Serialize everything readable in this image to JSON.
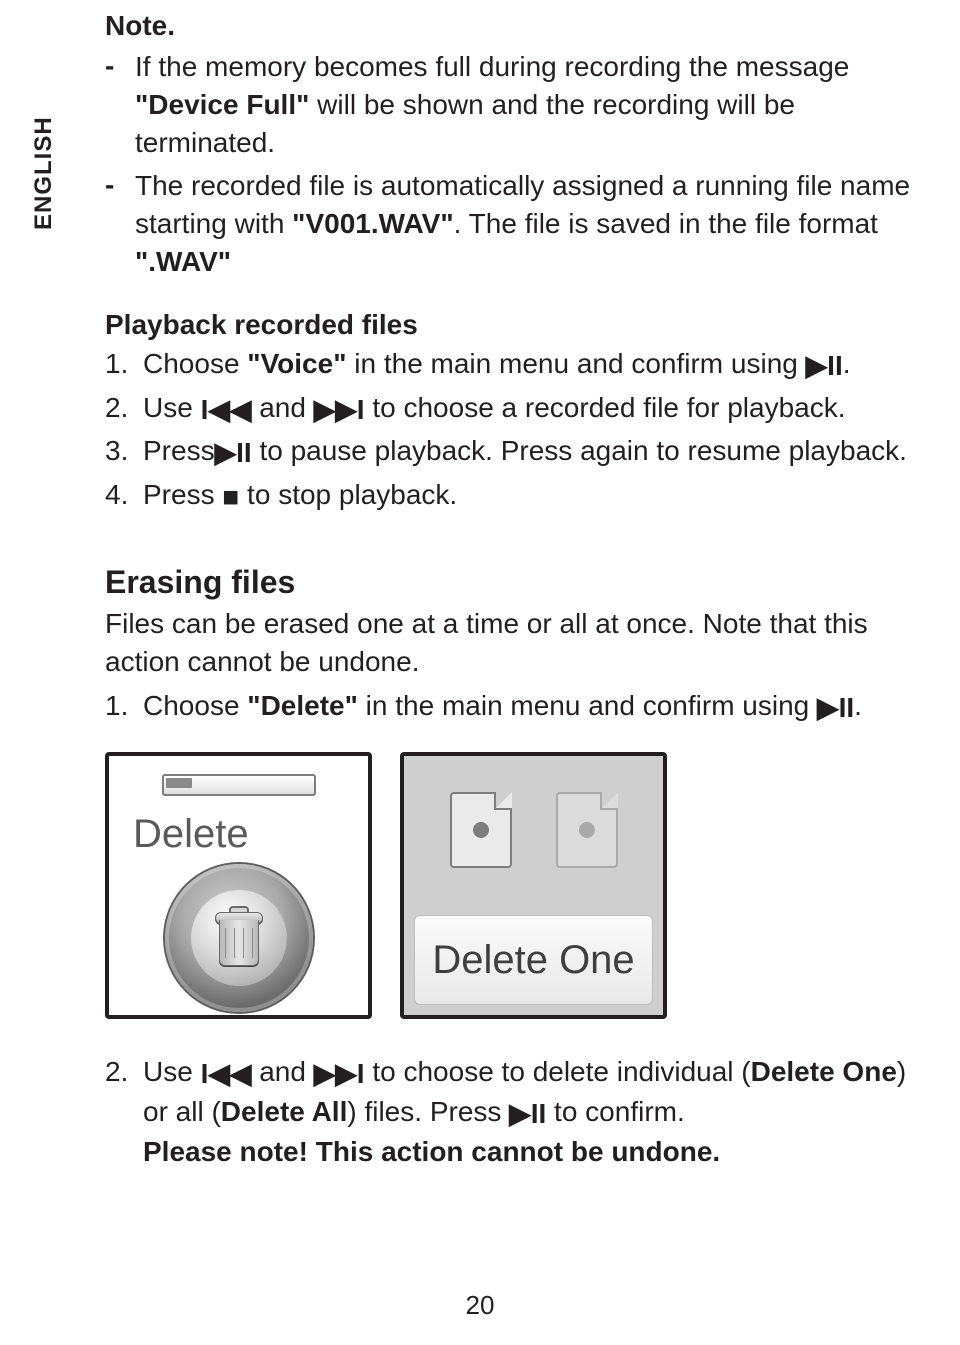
{
  "language_tab": "ENGLISH",
  "note": {
    "heading": "Note.",
    "items": [
      "If the memory becomes full during recording the message \"Device Full\" will be shown and the recording will be terminated.",
      "The recorded file is automatically assigned a running file name starting with \"V001.WAV\". The file is saved in the file format \".WAV\""
    ]
  },
  "playback": {
    "heading": "Playback recorded files",
    "steps": {
      "s1_a": "Choose ",
      "s1_b": "\"Voice\"",
      "s1_c": " in the main menu and confirm using ",
      "s1_d": ".",
      "s2_a": "Use ",
      "s2_b": " and ",
      "s2_c": " to choose a recorded file for playback.",
      "s3_a": "Press",
      "s3_b": " to pause playback. Press again to resume playback.",
      "s4_a": "Press ",
      "s4_b": " to stop playback."
    }
  },
  "erasing": {
    "heading": "Erasing files",
    "intro": "Files can be erased one at a time or all at once. Note that this action cannot be undone.",
    "step1_a": "Choose ",
    "step1_b": "\"Delete\"",
    "step1_c": " in the main menu and confirm using ",
    "step1_d": ".",
    "fig1_label": "Delete",
    "fig2_label": "Delete One",
    "step2_a": "Use ",
    "step2_b": " and ",
    "step2_c": " to choose to delete individual (",
    "step2_d": "Delete One",
    "step2_e": ") or all (",
    "step2_f": "Delete All",
    "step2_g": ") files. Press ",
    "step2_h": " to confirm.",
    "warn": "Please note! This action cannot be undone."
  },
  "page_number": "20"
}
